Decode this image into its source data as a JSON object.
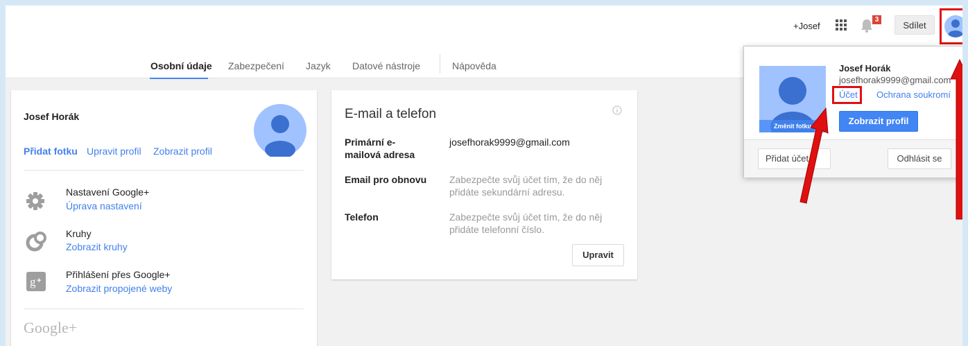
{
  "topbar": {
    "user_link": "+Josef",
    "notification_count": "3",
    "share_label": "Sdílet"
  },
  "tabs": [
    {
      "label": "Osobní údaje",
      "active": true
    },
    {
      "label": "Zabezpečení"
    },
    {
      "label": "Jazyk"
    },
    {
      "label": "Datové nástroje"
    },
    {
      "label": "Nápověda"
    }
  ],
  "profile_card": {
    "name": "Josef Horák",
    "add_photo": "Přidat fotku",
    "edit_profile": "Upravit profil",
    "view_profile": "Zobrazit profil",
    "items": [
      {
        "icon": "gear-icon",
        "title": "Nastavení Google+",
        "link": "Úprava nastavení"
      },
      {
        "icon": "circles-icon",
        "title": "Kruhy",
        "link": "Zobrazit kruhy"
      },
      {
        "icon": "google-plus-icon",
        "title": "Přihlášení přes Google+",
        "link": "Zobrazit propojené weby"
      }
    ],
    "logo": "Google+"
  },
  "email_card": {
    "title": "E-mail a telefon",
    "rows": [
      {
        "label": "Primární e-mailová adresa",
        "value": "josefhorak9999@gmail.com"
      },
      {
        "label": "Email pro obnovu",
        "value": "Zabezpečte svůj účet tím, že do něj přidáte sekundární adresu."
      },
      {
        "label": "Telefon",
        "value": "Zabezpečte svůj účet tím, že do něj přidáte telefonní číslo."
      }
    ],
    "edit_button": "Upravit"
  },
  "account_popup": {
    "name": "Josef Horák",
    "email": "josefhorak9999@gmail.com",
    "account_link": "Účet",
    "privacy_link": "Ochrana soukromí",
    "change_photo": "Změnit fotku",
    "view_profile_button": "Zobrazit profil",
    "add_account_button": "Přidat účet",
    "sign_out_button": "Odhlásit se"
  },
  "colors": {
    "accent_blue": "#4285f4",
    "link_blue": "#427fed",
    "highlight_red": "#e01010"
  }
}
